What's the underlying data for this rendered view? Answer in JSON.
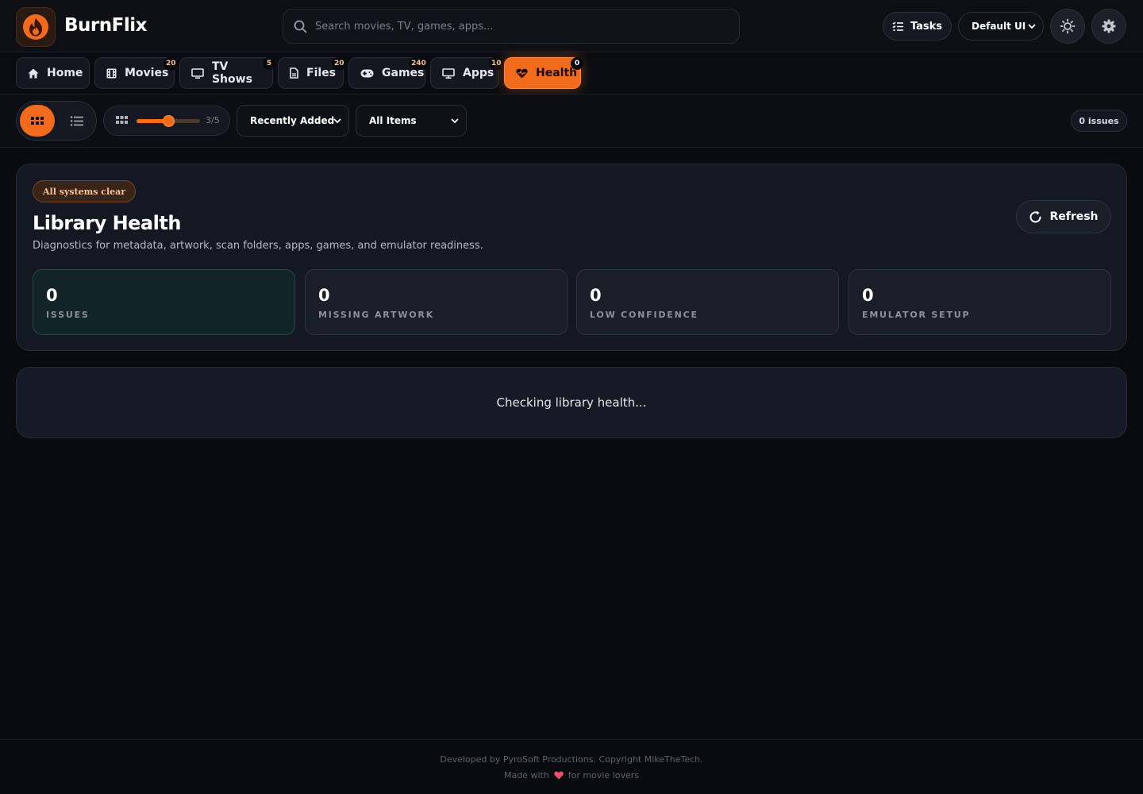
{
  "header": {
    "brand": "BurnFlix",
    "search_placeholder": "Search movies, TV, games, apps...",
    "tasks_label": "Tasks",
    "ui_mode": "Default UI"
  },
  "nav": {
    "tabs": [
      {
        "label": "Home",
        "icon": "home-icon",
        "badge": ""
      },
      {
        "label": "Movies",
        "icon": "film-icon",
        "badge": "20"
      },
      {
        "label": "TV Shows",
        "icon": "tv-icon",
        "badge": "5"
      },
      {
        "label": "Files",
        "icon": "file-icon",
        "badge": "20"
      },
      {
        "label": "Games",
        "icon": "gamepad-icon",
        "badge": "240"
      },
      {
        "label": "Apps",
        "icon": "monitor-icon",
        "badge": "10"
      },
      {
        "label": "Health",
        "icon": "heartbeat-icon",
        "badge": "0",
        "active": true
      }
    ]
  },
  "toolbar": {
    "size_value": "3/5",
    "size_level": 3,
    "size_max": 5,
    "sort_value": "Recently Added",
    "filter_value": "All Items",
    "issues_count_label": "0 issues"
  },
  "health": {
    "status_chip": "All systems clear",
    "title": "Library Health",
    "description": "Diagnostics for metadata, artwork, scan folders, apps, games, and emulator readiness.",
    "refresh_label": "Refresh",
    "stats": [
      {
        "value": "0",
        "label": "ISSUES"
      },
      {
        "value": "0",
        "label": "MISSING ARTWORK"
      },
      {
        "value": "0",
        "label": "LOW CONFIDENCE"
      },
      {
        "value": "0",
        "label": "EMULATOR SETUP"
      }
    ],
    "loading_text": "Checking library health..."
  },
  "footer": {
    "line1": "Developed by PyroSoft Productions. Copyright MikeTheTech.",
    "made_with": "Made with",
    "for_text": "for movie lovers"
  },
  "colors": {
    "accent": "#f26a1b",
    "background": "#0a0b0f",
    "panel": "#141823",
    "heart": "#e8506e"
  }
}
